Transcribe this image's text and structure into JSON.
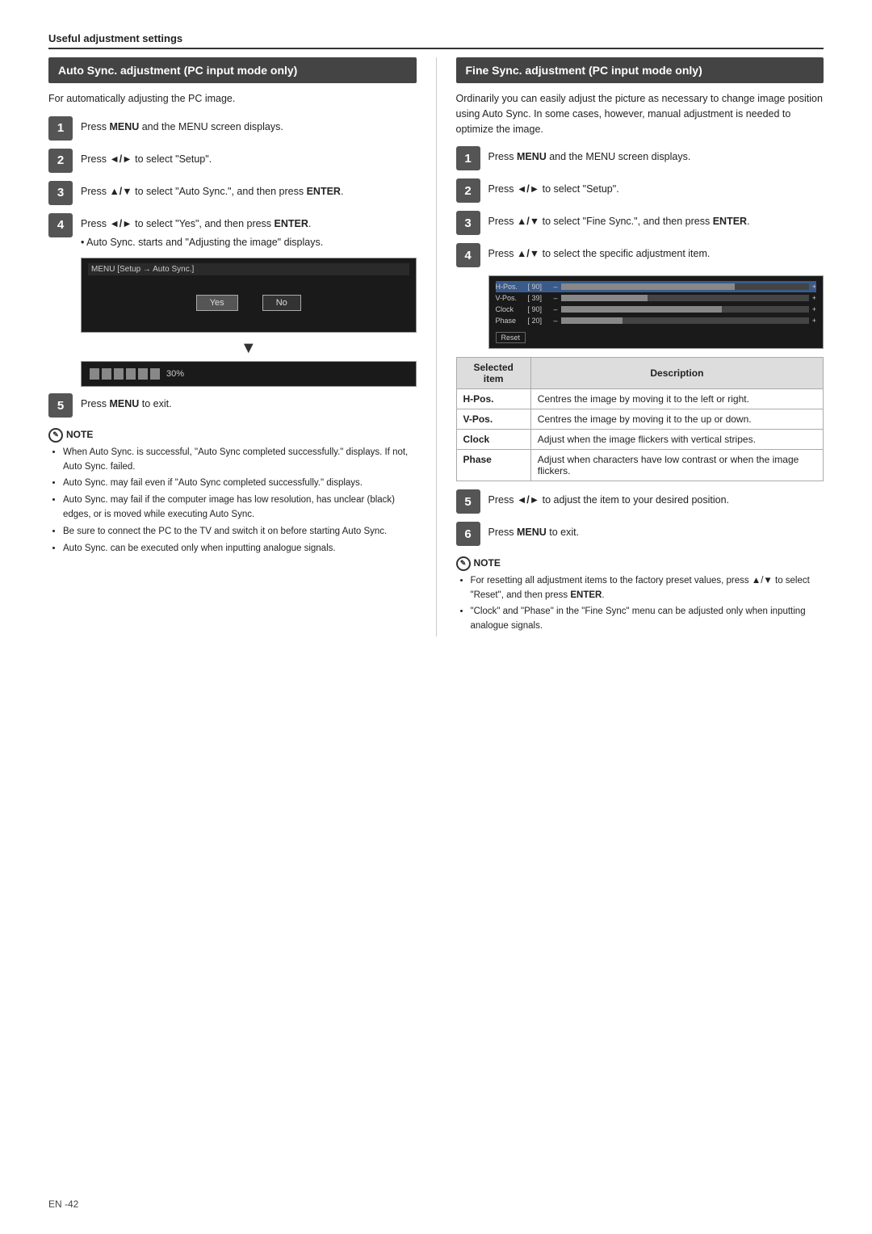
{
  "page": {
    "header": "Useful adjustment settings",
    "footer": "EN -42"
  },
  "left": {
    "title": "Auto Sync. adjustment (PC input mode only)",
    "intro": "For automatically adjusting the PC image.",
    "steps": [
      {
        "num": "1",
        "text_before": "Press ",
        "bold": "MENU",
        "text_after": " and the MENU screen displays."
      },
      {
        "num": "2",
        "text_before": "Press ",
        "bold": "◄/►",
        "text_after": " to select \"Setup\"."
      },
      {
        "num": "3",
        "text_before": "Press ",
        "bold": "▲/▼",
        "text_after": " to select \"Auto Sync.\", and then press ",
        "bold2": "ENTER",
        "text_after2": "."
      },
      {
        "num": "4",
        "text_before": "Press ",
        "bold": "◄/►",
        "text_after": " to select \"Yes\", and then press ",
        "bold2": "ENTER",
        "text_after2": ".",
        "bullet": "Auto Sync. starts and \"Adjusting the image\" displays."
      }
    ],
    "screen_menu_label": "MENU  [Setup → Auto Sync.]",
    "screen_btn_yes": "Yes",
    "screen_btn_no": "No",
    "progress_pct": "30%",
    "step5": {
      "num": "5",
      "text_before": "Press ",
      "bold": "MENU",
      "text_after": " to exit."
    },
    "note_title": "NOTE",
    "notes": [
      "When Auto Sync. is successful, \"Auto Sync completed successfully.\" displays. If not, Auto Sync. failed.",
      "Auto Sync. may fail even if \"Auto Sync completed successfully.\" displays.",
      "Auto Sync. may fail if the computer image has low resolution, has unclear (black) edges, or is moved while executing Auto Sync.",
      "Be sure to connect the PC to the TV and switch it on before starting Auto Sync.",
      "Auto Sync. can be executed only when inputting analogue signals."
    ]
  },
  "right": {
    "title": "Fine Sync. adjustment (PC input mode only)",
    "intro": "Ordinarily you can easily adjust the picture as necessary to change image position using Auto Sync. In some cases, however, manual adjustment is needed to optimize the image.",
    "steps": [
      {
        "num": "1",
        "text_before": "Press ",
        "bold": "MENU",
        "text_after": " and the MENU screen displays."
      },
      {
        "num": "2",
        "text_before": "Press ",
        "bold": "◄/►",
        "text_after": " to select \"Setup\"."
      },
      {
        "num": "3",
        "text_before": "Press ",
        "bold": "▲/▼",
        "text_after": " to select \"Fine Sync.\", and then press ",
        "bold2": "ENTER",
        "text_after2": "."
      },
      {
        "num": "4",
        "text_before": "Press ",
        "bold": "▲/▼",
        "text_after": " to select the specific adjustment item."
      }
    ],
    "fine_sync_items": [
      {
        "label": "H-Pos.",
        "val": "90",
        "fill_pct": 70,
        "highlight": false
      },
      {
        "label": "V-Pos.",
        "val": "39",
        "fill_pct": 35,
        "highlight": false
      },
      {
        "label": "Clock",
        "val": "90",
        "fill_pct": 65,
        "highlight": false
      },
      {
        "label": "Phase",
        "val": "20",
        "fill_pct": 25,
        "highlight": false
      }
    ],
    "fine_sync_reset": "Reset",
    "table": {
      "headers": [
        "Selected item",
        "Description"
      ],
      "rows": [
        {
          "item": "H-Pos.",
          "desc": "Centres the image by moving it to the left or right."
        },
        {
          "item": "V-Pos.",
          "desc": "Centres the image by moving it to the up or down."
        },
        {
          "item": "Clock",
          "desc": "Adjust when the image flickers with vertical stripes."
        },
        {
          "item": "Phase",
          "desc": "Adjust when characters have low contrast or when the image flickers."
        }
      ]
    },
    "step5": {
      "num": "5",
      "text_before": "Press ",
      "bold": "◄/►",
      "text_after": " to adjust the item to your desired position."
    },
    "step6": {
      "num": "6",
      "text_before": "Press ",
      "bold": "MENU",
      "text_after": " to exit."
    },
    "note_title": "NOTE",
    "notes": [
      {
        "text": "For resetting all adjustment items to the factory preset values, press ▲/▼ to select \"Reset\", and then press ENTER.",
        "bold_end": "ENTER"
      },
      {
        "text": "\"Clock\" and \"Phase\" in the \"Fine Sync\" menu can be adjusted only when inputting analogue signals."
      }
    ]
  }
}
